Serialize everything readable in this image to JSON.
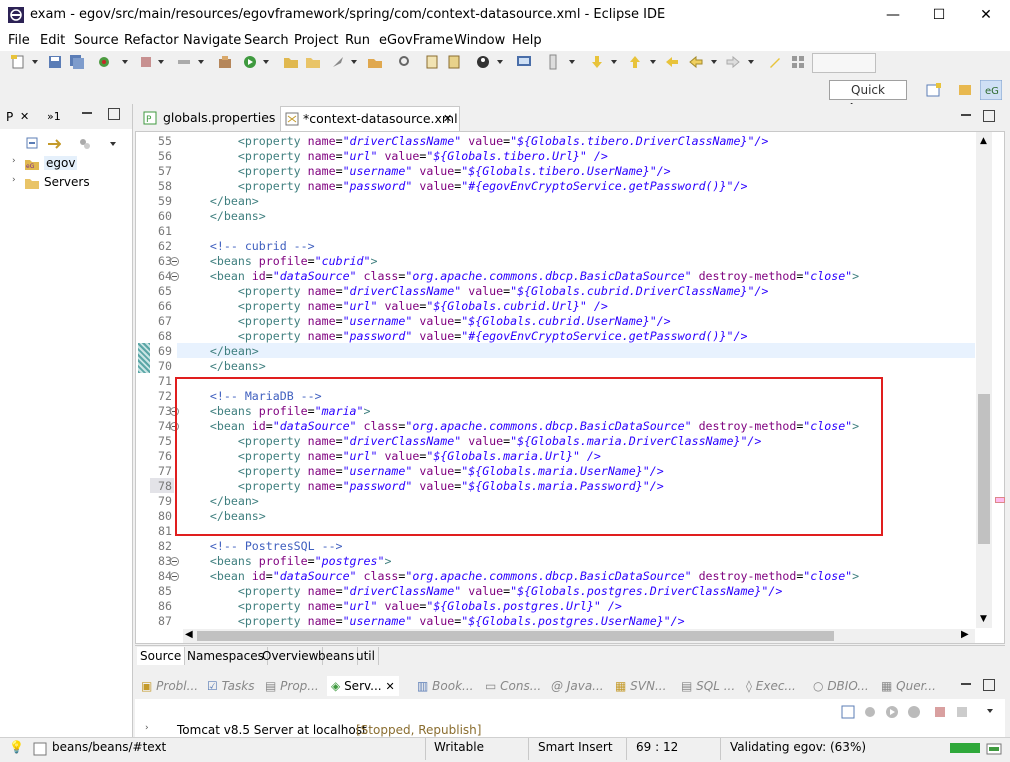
{
  "window": {
    "title": "exam - egov/src/main/resources/egovframework/spring/com/context-datasource.xml - Eclipse IDE",
    "minimize": "—",
    "maximize": "☐",
    "close": "✕"
  },
  "menu": [
    "File",
    "Edit",
    "Source",
    "Refactor",
    "Navigate",
    "Search",
    "Project",
    "Run",
    "eGovFrame",
    "Window",
    "Help"
  ],
  "toolbar": {
    "quick_access": "Quick Access"
  },
  "left_panel": {
    "tab_p": "P",
    "tab_close": "✕",
    "tab_hier": "»1",
    "tree": [
      {
        "label": "egov"
      },
      {
        "label": "Servers"
      }
    ]
  },
  "editor": {
    "tabs": [
      {
        "label": "globals.properties"
      },
      {
        "label": "*context-datasource.xml"
      }
    ],
    "tab_close": "✕",
    "lines": [
      {
        "n": "55",
        "indent": "        ",
        "kind": "prop",
        "name": "driverClassName",
        "value": "${Globals.tibero.DriverClassName}",
        "end": "\"/>"
      },
      {
        "n": "56",
        "indent": "        ",
        "kind": "prop",
        "name": "url",
        "value": "${Globals.tibero.Url}",
        "end": "\" />"
      },
      {
        "n": "57",
        "indent": "        ",
        "kind": "prop",
        "name": "username",
        "value": "${Globals.tibero.UserName}",
        "end": "\"/>"
      },
      {
        "n": "58",
        "indent": "        ",
        "kind": "prop",
        "name": "password",
        "value": "#{egovEnvCryptoService.getPassword()}",
        "end": "\"/>"
      },
      {
        "n": "59",
        "indent": "    ",
        "kind": "text",
        "text": "</bean>"
      },
      {
        "n": "60",
        "indent": "    ",
        "kind": "text",
        "text": "</beans>"
      },
      {
        "n": "61",
        "indent": "",
        "kind": "text",
        "text": ""
      },
      {
        "n": "62",
        "indent": "    ",
        "kind": "comment",
        "text": "<!-- cubrid -->"
      },
      {
        "n": "63",
        "indent": "    ",
        "kind": "beans",
        "profile": "cubrid"
      },
      {
        "n": "64",
        "indent": "    ",
        "kind": "bean",
        "id": "dataSource",
        "class": "org.apache.commons.dbcp.BasicDataSource",
        "destroy": "close"
      },
      {
        "n": "65",
        "indent": "        ",
        "kind": "prop",
        "name": "driverClassName",
        "value": "${Globals.cubrid.DriverClassName}",
        "end": "\"/>"
      },
      {
        "n": "66",
        "indent": "        ",
        "kind": "prop",
        "name": "url",
        "value": "${Globals.cubrid.Url}",
        "end": "\" />"
      },
      {
        "n": "67",
        "indent": "        ",
        "kind": "prop",
        "name": "username",
        "value": "${Globals.cubrid.UserName}",
        "end": "\"/>"
      },
      {
        "n": "68",
        "indent": "        ",
        "kind": "prop",
        "name": "password",
        "value": "#{egovEnvCryptoService.getPassword()}",
        "end": "\"/>"
      },
      {
        "n": "69",
        "indent": "    ",
        "kind": "text",
        "text": "</bean>"
      },
      {
        "n": "70",
        "indent": "    ",
        "kind": "text",
        "text": "</beans>"
      },
      {
        "n": "71",
        "indent": "",
        "kind": "text",
        "text": ""
      },
      {
        "n": "72",
        "indent": "    ",
        "kind": "comment",
        "text": "<!-- MariaDB -->"
      },
      {
        "n": "73",
        "indent": "    ",
        "kind": "beans",
        "profile": "maria"
      },
      {
        "n": "74",
        "indent": "    ",
        "kind": "bean",
        "id": "dataSource",
        "class": "org.apache.commons.dbcp.BasicDataSource",
        "destroy": "close"
      },
      {
        "n": "75",
        "indent": "        ",
        "kind": "prop",
        "name": "driverClassName",
        "value": "${Globals.maria.DriverClassName}",
        "end": "\"/>"
      },
      {
        "n": "76",
        "indent": "        ",
        "kind": "prop",
        "name": "url",
        "value": "${Globals.maria.Url}",
        "end": "\" />"
      },
      {
        "n": "77",
        "indent": "        ",
        "kind": "prop",
        "name": "username",
        "value": "${Globals.maria.UserName}",
        "end": "\"/>"
      },
      {
        "n": "78",
        "indent": "        ",
        "kind": "prop",
        "name": "password",
        "value": "${Globals.maria.Password}",
        "end": "\"/>"
      },
      {
        "n": "79",
        "indent": "    ",
        "kind": "text",
        "text": "</bean>"
      },
      {
        "n": "80",
        "indent": "    ",
        "kind": "text",
        "text": "</beans>"
      },
      {
        "n": "81",
        "indent": "",
        "kind": "text",
        "text": ""
      },
      {
        "n": "82",
        "indent": "    ",
        "kind": "comment",
        "text": "<!-- PostresSQL -->"
      },
      {
        "n": "83",
        "indent": "    ",
        "kind": "beans",
        "profile": "postgres"
      },
      {
        "n": "84",
        "indent": "    ",
        "kind": "bean",
        "id": "dataSource",
        "class": "org.apache.commons.dbcp.BasicDataSource",
        "destroy": "close"
      },
      {
        "n": "85",
        "indent": "        ",
        "kind": "prop",
        "name": "driverClassName",
        "value": "${Globals.postgres.DriverClassName}",
        "end": "\"/>"
      },
      {
        "n": "86",
        "indent": "        ",
        "kind": "prop",
        "name": "url",
        "value": "${Globals.postgres.Url}",
        "end": "\" />"
      },
      {
        "n": "87",
        "indent": "        ",
        "kind": "prop",
        "name": "username",
        "value": "${Globals.postgres.UserName}",
        "end": "\"/>"
      }
    ],
    "bottom_tabs": [
      "Source",
      "Namespaces",
      "Overview",
      "beans",
      "util"
    ]
  },
  "lower_panel": {
    "tabs": [
      "Probl...",
      "Tasks",
      "Prop...",
      "Serv...",
      "Book...",
      "Cons...",
      "Java...",
      "SVN...",
      "SQL ...",
      "Exec...",
      "DBIO...",
      "Quer..."
    ],
    "server_entry": "Tomcat v8.5 Server at localhost",
    "server_state": "[Stopped, Republish]"
  },
  "status": {
    "path": "beans/beans/#text",
    "mode": "Writable",
    "insert": "Smart Insert",
    "position": "69 : 12",
    "task": "Validating egov: (63%)"
  },
  "colors": {
    "highlight": "#e01e1e",
    "tag": "#3f7f7f",
    "attr": "#7f007f",
    "value": "#2a00ff",
    "comment": "#3f5fbf"
  }
}
